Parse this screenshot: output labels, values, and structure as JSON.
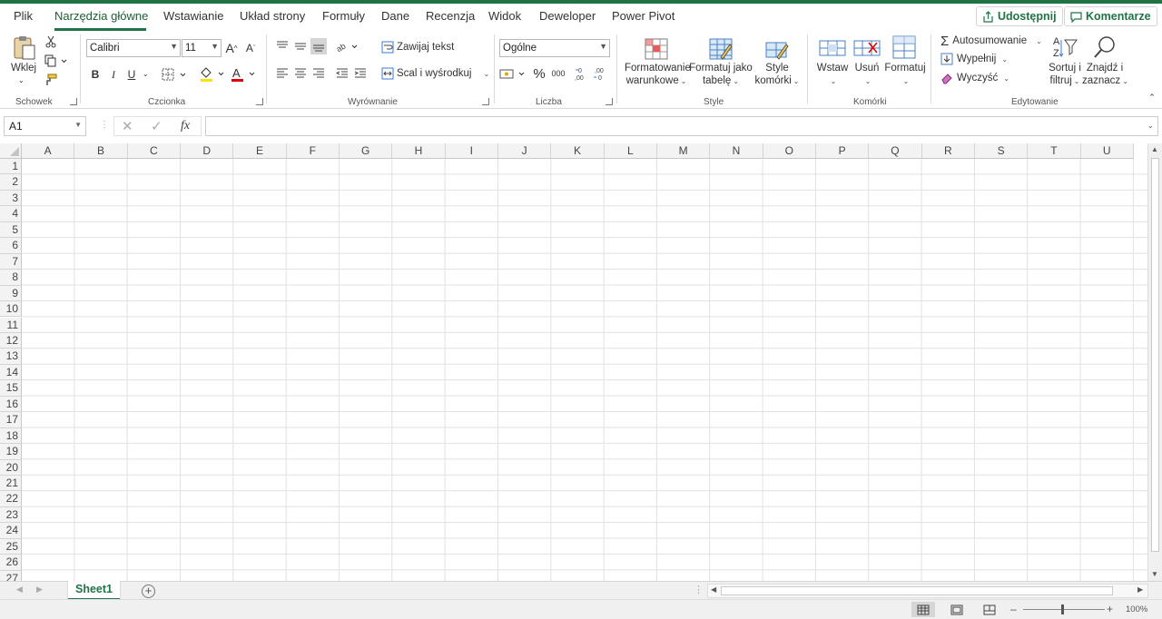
{
  "tabs": [
    "Plik",
    "Narzędzia główne",
    "Wstawianie",
    "Układ strony",
    "Formuły",
    "Dane",
    "Recenzja",
    "Widok",
    "Deweloper",
    "Power Pivot"
  ],
  "active_tab": "Narzędzia główne",
  "share_label": "Udostępnij",
  "comments_label": "Komentarze",
  "ribbon": {
    "clipboard": {
      "paste_label": "Wklej",
      "group_label": "Schowek"
    },
    "font": {
      "font_name": "Calibri",
      "font_size": "11",
      "bold": "B",
      "italic": "I",
      "underline": "U",
      "group_label": "Czcionka"
    },
    "alignment": {
      "wrap_text": "Zawijaj tekst",
      "merge_center": "Scal i wyśrodkuj",
      "group_label": "Wyrównanie"
    },
    "number": {
      "format": "Ogólne",
      "group_label": "Liczba"
    },
    "styles": {
      "conditional_line1": "Formatowanie",
      "conditional_line2": "warunkowe",
      "table_line1": "Formatuj jako",
      "table_line2": "tabelę",
      "cell_line1": "Style",
      "cell_line2": "komórki",
      "group_label": "Style"
    },
    "cells": {
      "insert": "Wstaw",
      "delete": "Usuń",
      "format": "Formatuj",
      "group_label": "Komórki"
    },
    "editing": {
      "autosum": "Autosumowanie",
      "fill": "Wypełnij",
      "clear": "Wyczyść",
      "sort_line1": "Sortuj i",
      "sort_line2": "filtruj",
      "find_line1": "Znajdź i",
      "find_line2": "zaznacz",
      "group_label": "Edytowanie"
    }
  },
  "name_box": "A1",
  "fx_symbol": "fx",
  "columns": [
    "A",
    "B",
    "C",
    "D",
    "E",
    "F",
    "G",
    "H",
    "I",
    "J",
    "K",
    "L",
    "M",
    "N",
    "O",
    "P",
    "Q",
    "R",
    "S",
    "T",
    "U"
  ],
  "rows": [
    "1",
    "2",
    "3",
    "4",
    "5",
    "6",
    "7",
    "8",
    "9",
    "10",
    "11",
    "12",
    "13",
    "14",
    "15",
    "16",
    "17",
    "18",
    "19",
    "20",
    "21",
    "22",
    "23",
    "24",
    "25",
    "26",
    "27"
  ],
  "sheet_name": "Sheet1",
  "zoom": "100%",
  "colors": {
    "accent": "#217346",
    "font_color_bar": "#e00000",
    "highlight_bar": "#f5e600"
  }
}
